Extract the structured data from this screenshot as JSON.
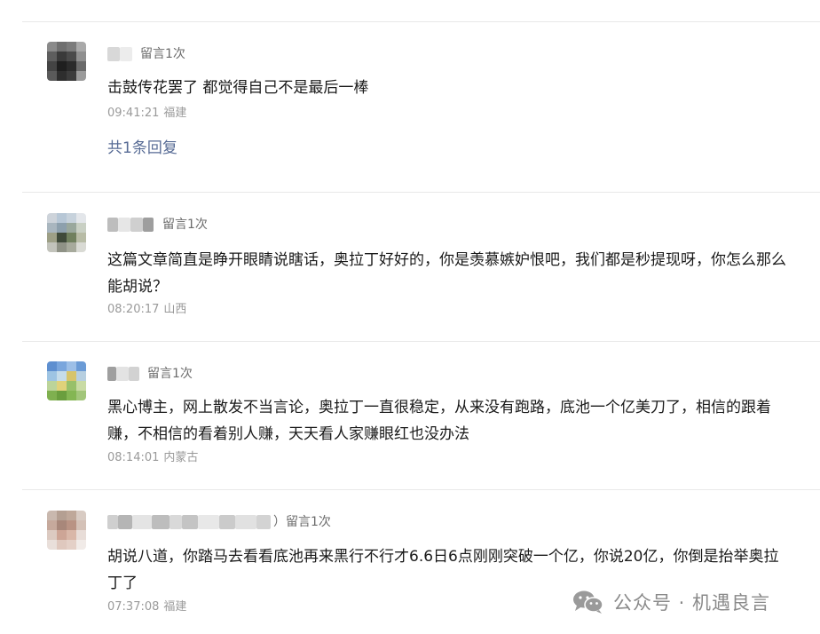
{
  "comments": [
    {
      "badge": "留言1次",
      "text": "击鼓传花罢了  都觉得自己不是最后一棒",
      "time": "09:41:21",
      "location": "福建",
      "replies_label": "共1条回复"
    },
    {
      "badge": "留言1次",
      "text": "这篇文章简直是睁开眼睛说瞎话，奥拉丁好好的，你是羡慕嫉妒恨吧，我们都是秒提现呀，你怎么那么能胡说？",
      "time": "08:20:17",
      "location": "山西"
    },
    {
      "badge": "留言1次",
      "text": "黑心博主，网上散发不当言论，奥拉丁一直很稳定，从来没有跑路，底池一个亿美刀了，相信的跟着赚，不相信的看着别人赚，天天看人家赚眼红也没办法",
      "time": "08:14:01",
      "location": "内蒙古"
    },
    {
      "badge": "留言1次",
      "nick_suffix": "）",
      "text": "胡说八道，你踏马去看看底池再来黑行不行才6.6日6点刚刚突破一个亿，你说20亿，你倒是抬举奥拉丁了",
      "time": "07:37:08",
      "location": "福建"
    }
  ],
  "watermark": {
    "text": "公众号 · 机遇良言",
    "icon": "wechat-icon"
  },
  "colors": {
    "link": "#576b95",
    "meta": "#9a9a9a",
    "divider": "#e9e9e9"
  }
}
